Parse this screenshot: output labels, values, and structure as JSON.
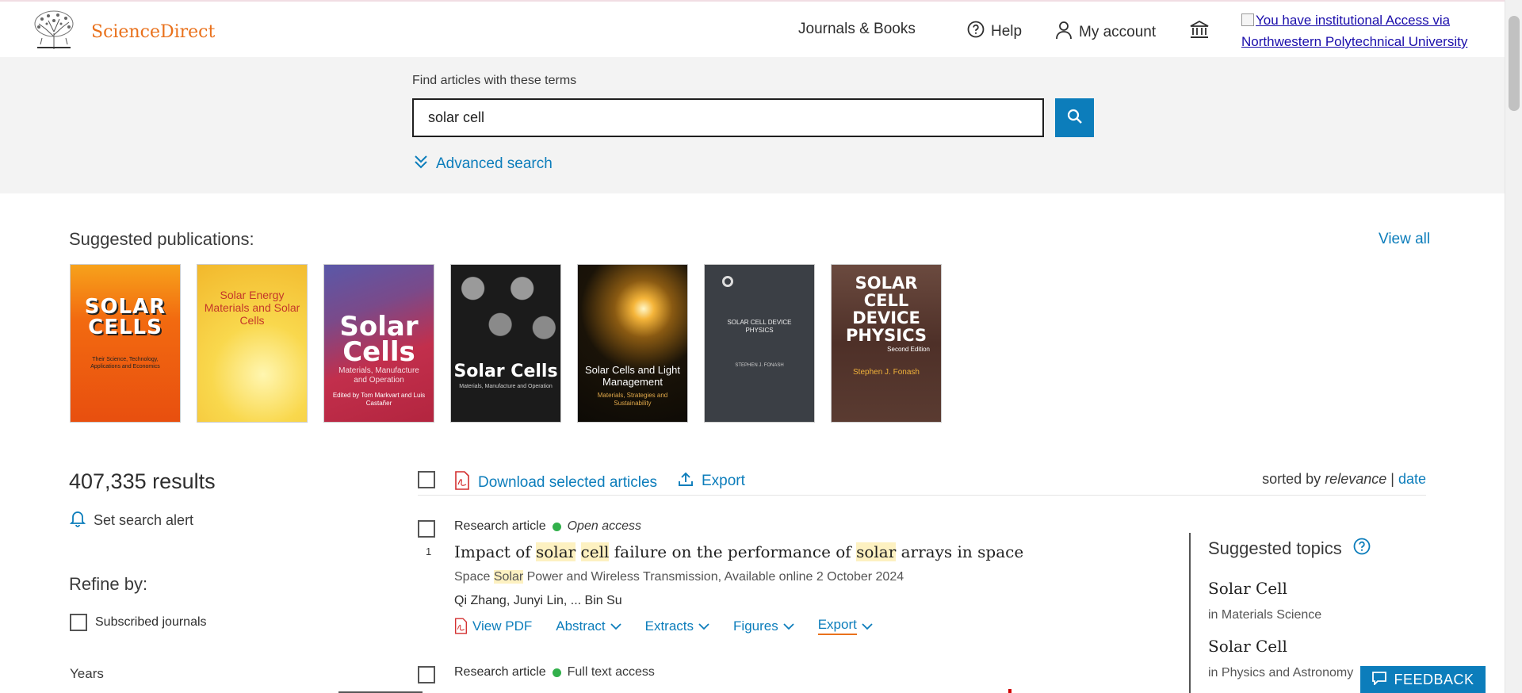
{
  "brand": {
    "name": "ScienceDirect",
    "color": "#e9711c"
  },
  "header": {
    "journals_books": "Journals & Books",
    "help": "Help",
    "my_account": "My account",
    "institution_link": "You have institutional Access via Northwestern Polytechnical University",
    "icons": [
      "elsevier-tree-logo",
      "help-circle-icon",
      "user-icon",
      "institution-icon"
    ]
  },
  "search": {
    "label": "Find articles with these terms",
    "value": "solar cell",
    "advanced_label": "Advanced search",
    "accent_color": "#0c7dbb"
  },
  "suggested_publications": {
    "title": "Suggested publications:",
    "view_all": "View all",
    "covers": [
      {
        "title": "SOLAR CELLS",
        "subtitle": "Their Science, Technology, Applications and Economics",
        "color": "#f36b12"
      },
      {
        "title": "Solar Energy Materials and Solar Cells",
        "color": "#f7c437"
      },
      {
        "title": "Solar Cells",
        "subtitle": "Materials, Manufacture and Operation",
        "editors": "Edited by Tom Markvart and Luis Castañer",
        "color": "#b52a4a"
      },
      {
        "title": "Solar Cells",
        "subtitle": "Materials, Manufacture and Operation",
        "color": "#1b1b1b"
      },
      {
        "title": "Solar Cells and Light Management",
        "subtitle": "Materials, Strategies and Sustainability",
        "color": "#1a1308"
      },
      {
        "title": "SOLAR CELL DEVICE PHYSICS",
        "author": "STEPHEN J. FONASH",
        "color": "#3b3f45"
      },
      {
        "title": "SOLAR CELL DEVICE PHYSICS",
        "edition": "Second Edition",
        "author": "Stephen J. Fonash",
        "color": "#5a3a30"
      }
    ]
  },
  "results": {
    "count": "407,335 results",
    "set_alert": "Set search alert",
    "refine_by": "Refine by:",
    "subscribed_journals": "Subscribed journals",
    "years": "Years",
    "download_selected": "Download selected articles",
    "export": "Export",
    "sorted_by": "sorted by",
    "sort_relevance": "relevance",
    "sort_separator": "|",
    "sort_date": "date",
    "items": [
      {
        "number": "1",
        "type": "Research article",
        "access": "Open access",
        "title_parts": [
          "Impact of ",
          "solar",
          " ",
          "cell",
          " failure on the performance of ",
          "solar",
          " arrays in space"
        ],
        "source_parts": [
          "Space ",
          "Solar",
          " Power and Wireless Transmission, Available online 2 October 2024"
        ],
        "authors": "Qi Zhang, Junyi Lin, ... Bin Su",
        "actions": {
          "view_pdf": "View PDF",
          "abstract": "Abstract",
          "extracts": "Extracts",
          "figures": "Figures",
          "export": "Export"
        }
      },
      {
        "type": "Research article",
        "access": "Full text access"
      }
    ]
  },
  "suggested_topics": {
    "title": "Suggested topics",
    "items": [
      {
        "name": "Solar Cell",
        "field": "in Materials Science"
      },
      {
        "name": "Solar Cell",
        "field": "in Physics and Astronomy"
      }
    ]
  },
  "feedback": "FEEDBACK"
}
